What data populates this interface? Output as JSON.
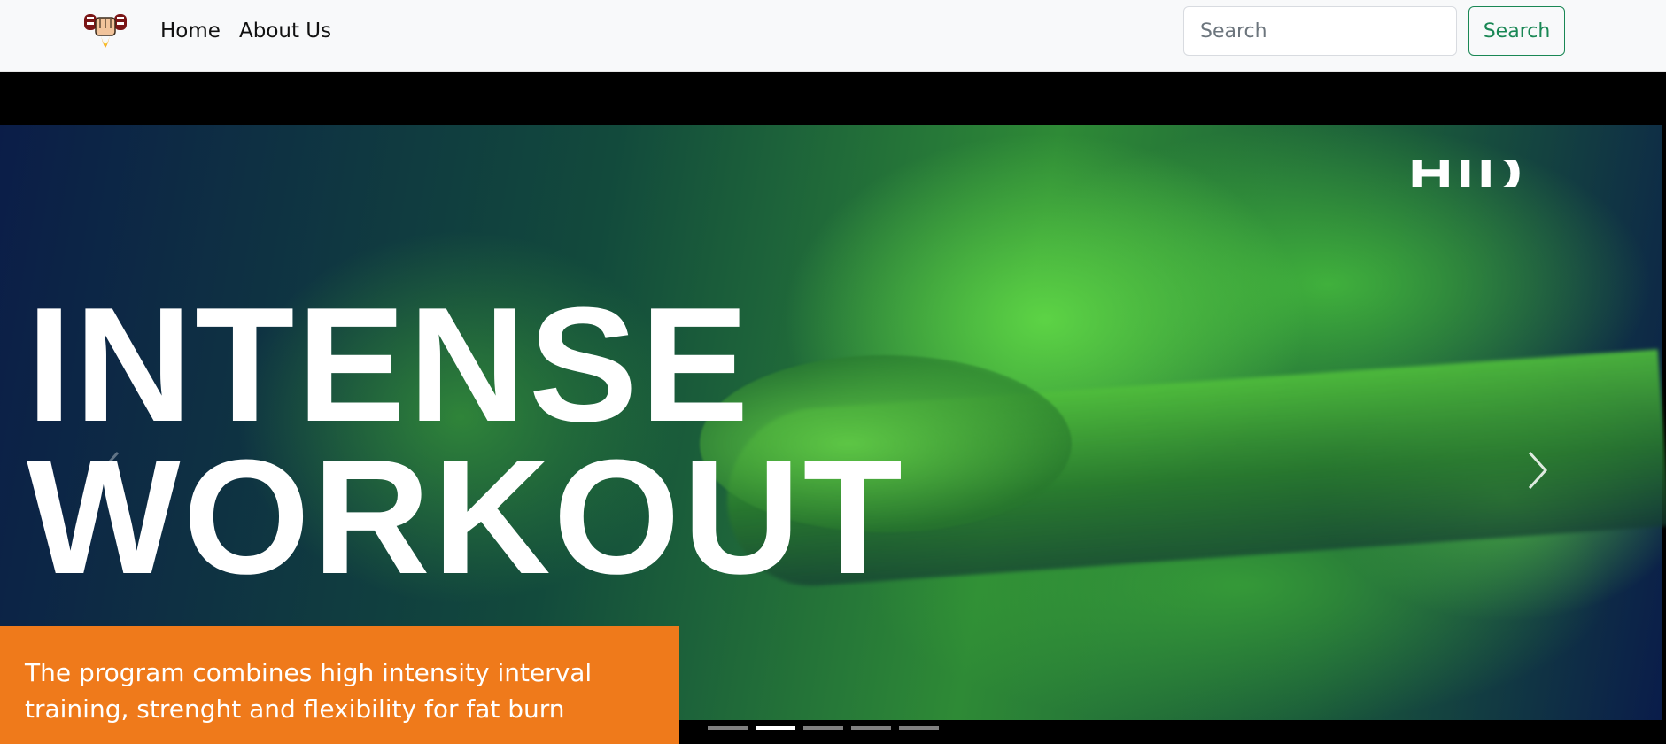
{
  "navbar": {
    "logo_icon": "flexing-fist-flame-logo",
    "links": [
      {
        "label": "Home"
      },
      {
        "label": "About Us"
      }
    ],
    "search": {
      "placeholder": "Search",
      "value": "",
      "button_label": "Search"
    }
  },
  "carousel": {
    "headline_line1": "INTENSE",
    "headline_line2": "WORKOUT",
    "partial_top_text": "HID",
    "caption_line1": "The program combines high intensity interval",
    "caption_line2": "training, strenght and flexibility for fat burn",
    "indicator_count": 5,
    "active_indicator": 2,
    "prev_icon": "chevron-left-icon",
    "next_icon": "chevron-right-icon",
    "caption_color": "#ef7a1b"
  },
  "colors": {
    "accent_green": "#198754",
    "navbar_bg": "#f8f9fa"
  }
}
